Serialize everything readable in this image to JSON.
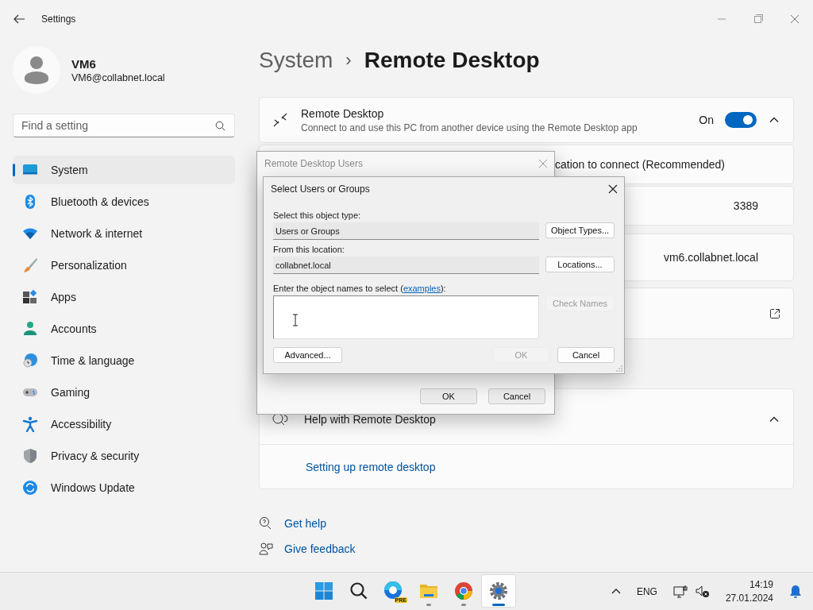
{
  "window": {
    "title": "Settings"
  },
  "account": {
    "name": "VM6",
    "email": "VM6@collabnet.local"
  },
  "search": {
    "placeholder": "Find a setting"
  },
  "nav": [
    {
      "kind": "system",
      "label": "System",
      "selected": true
    },
    {
      "kind": "bluetooth",
      "label": "Bluetooth & devices",
      "selected": false
    },
    {
      "kind": "network",
      "label": "Network & internet",
      "selected": false
    },
    {
      "kind": "brush",
      "label": "Personalization",
      "selected": false
    },
    {
      "kind": "apps",
      "label": "Apps",
      "selected": false
    },
    {
      "kind": "accounts",
      "label": "Accounts",
      "selected": false
    },
    {
      "kind": "time",
      "label": "Time & language",
      "selected": false
    },
    {
      "kind": "gaming",
      "label": "Gaming",
      "selected": false
    },
    {
      "kind": "accessibility",
      "label": "Accessibility",
      "selected": false
    },
    {
      "kind": "privacy",
      "label": "Privacy & security",
      "selected": false
    },
    {
      "kind": "update",
      "label": "Windows Update",
      "selected": false
    }
  ],
  "breadcrumb": {
    "parent": "System",
    "separator": "›",
    "current": "Remote Desktop"
  },
  "remote_desktop": {
    "title": "Remote Desktop",
    "description": "Connect to and use this PC from another device using the Remote Desktop app",
    "state_label": "On",
    "on": true,
    "expanded": true
  },
  "rows": [
    {
      "kind": "text",
      "text": "cation to connect (Recommended)"
    },
    {
      "kind": "value",
      "text": "3389"
    },
    {
      "kind": "value",
      "text": "vm6.collabnet.local"
    },
    {
      "kind": "external"
    }
  ],
  "help": {
    "title": "Help with Remote Desktop",
    "expanded": true,
    "link": "Setting up remote desktop"
  },
  "footer_links": [
    {
      "kind": "help",
      "label": "Get help"
    },
    {
      "kind": "feedback",
      "label": "Give feedback"
    }
  ],
  "dialog_users": {
    "title": "Remote Desktop Users",
    "buttons": [
      "OK",
      "Cancel"
    ]
  },
  "dialog_select": {
    "title": "Select Users or Groups",
    "object_type_label": "Select this object type:",
    "object_type": "Users or Groups",
    "object_types_button": "Object Types...",
    "location_label": "From this location:",
    "location": "collabnet.local",
    "locations_button": "Locations...",
    "names_label_before": "Enter the object names to select (",
    "names_link": "examples",
    "names_label_after": "):",
    "check_names": {
      "label": "Check Names",
      "disabled": true
    },
    "advanced": "Advanced...",
    "ok": {
      "label": "OK",
      "disabled": true
    },
    "cancel": {
      "label": "Cancel",
      "disabled": false
    }
  },
  "taskbar": {
    "apps": [
      {
        "kind": "start",
        "running": false,
        "selected": false
      },
      {
        "kind": "search",
        "running": false,
        "selected": false
      },
      {
        "kind": "edge",
        "badge": "PRE",
        "running": false,
        "selected": false
      },
      {
        "kind": "files",
        "running": true,
        "selected": false
      },
      {
        "kind": "chrome",
        "running": true,
        "selected": false
      },
      {
        "kind": "settings",
        "running": true,
        "selected": true
      }
    ],
    "language": "ENG",
    "time": "14:19",
    "date": "27.01.2024"
  }
}
